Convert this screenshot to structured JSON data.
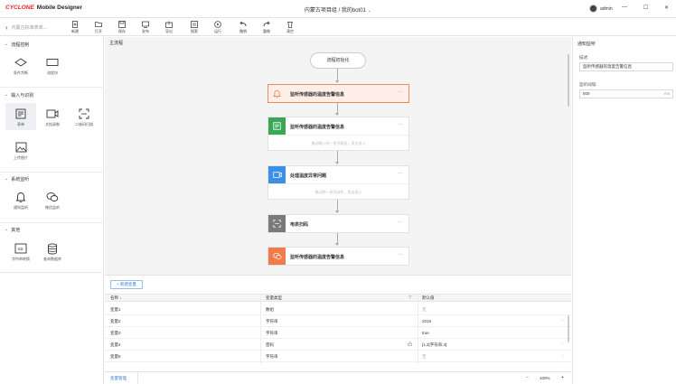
{
  "app": {
    "brand": "CYCLONE",
    "product": "Mobile Designer",
    "title": "内蒙古项目组 / 我的bot01",
    "user": "admin"
  },
  "window_controls": {
    "minimize": "—",
    "maximize": "☐",
    "close": "✕"
  },
  "toolbar": {
    "project_label": "内蒙古标准表单...",
    "buttons": [
      {
        "label": "新建",
        "icon": "new-file-icon"
      },
      {
        "label": "打开",
        "icon": "open-icon"
      },
      {
        "label": "保存",
        "icon": "save-icon"
      },
      {
        "label": "发布",
        "icon": "publish-icon"
      },
      {
        "label": "导出",
        "icon": "export-icon"
      },
      {
        "label": "搜索",
        "icon": "search-icon"
      },
      {
        "label": "运行",
        "icon": "run-icon"
      },
      {
        "label": "撤销",
        "icon": "undo-icon"
      },
      {
        "label": "重做",
        "icon": "redo-icon"
      },
      {
        "label": "清空",
        "icon": "delete-icon"
      }
    ]
  },
  "left_panel": {
    "sections": [
      {
        "title": "流程控制",
        "items": [
          {
            "label": "条件判断",
            "icon": "diamond-icon"
          },
          {
            "label": "流程块",
            "icon": "rectangle-icon"
          }
        ]
      },
      {
        "title": "输入与识别",
        "items": [
          {
            "label": "表单",
            "icon": "form-icon"
          },
          {
            "label": "文档录制",
            "icon": "video-icon"
          },
          {
            "label": "二维码扫描",
            "icon": "scan-icon"
          },
          {
            "label": "上传图片",
            "icon": "image-icon"
          }
        ]
      },
      {
        "title": "系统监听",
        "items": [
          {
            "label": "通知监听",
            "icon": "bell-icon"
          },
          {
            "label": "微信监听",
            "icon": "wechat-icon"
          }
        ]
      },
      {
        "title": "其他",
        "items": [
          {
            "label": "字符串转换",
            "icon": "string-icon"
          },
          {
            "label": "查询数据库",
            "icon": "database-icon"
          }
        ]
      }
    ]
  },
  "canvas": {
    "tab": "主流程",
    "start_node": "流程初始化",
    "nodes": [
      {
        "title": "监听传感器的温度告警信息",
        "icon": "bell-icon",
        "color": "#f07c4a",
        "active": true,
        "sub": ""
      },
      {
        "title": "监听传感器的温度告警信息",
        "icon": "form-icon",
        "color": "#3aa757",
        "active": false,
        "sub": "拖动输入的一系列表组，双击进入"
      },
      {
        "title": "处理温度异常问题",
        "icon": "video-icon",
        "color": "#3b8fe8",
        "active": false,
        "sub": "拖动到一系列动作，双击进入"
      },
      {
        "title": "电表扫码",
        "icon": "scan-icon",
        "color": "#7a7a7a",
        "active": false,
        "sub": ""
      },
      {
        "title": "监听传感器的温度告警信息",
        "icon": "wechat-icon",
        "color": "#f07c4a",
        "active": false,
        "sub": ""
      }
    ],
    "more": "···"
  },
  "variables": {
    "new_button": "+ 新建变量",
    "columns": {
      "name": "名称 ↓",
      "type": "变量类型",
      "default": "默认值"
    },
    "rows": [
      {
        "name": "变量1",
        "type": "数组",
        "value": "无",
        "muted": true
      },
      {
        "name": "变量2",
        "type": "字符串",
        "value": "2019",
        "muted": false
      },
      {
        "name": "变量3",
        "type": "字符串",
        "value": "true",
        "muted": false
      },
      {
        "name": "变量4",
        "type": "密码",
        "value": "[1,2[字符串,3]",
        "muted": false
      },
      {
        "name": "变量5",
        "type": "字符串",
        "value": "无",
        "muted": true
      }
    ],
    "manage_link": "变量管理",
    "zoom": "100%",
    "zoom_out": "−",
    "zoom_in": "+"
  },
  "right_panel": {
    "title": "通知监听",
    "desc_label": "描述:",
    "desc_value": "监听传感器的温度告警信息",
    "interval_label": "监听间隔:",
    "interval_value": "500",
    "interval_unit": "ms"
  }
}
